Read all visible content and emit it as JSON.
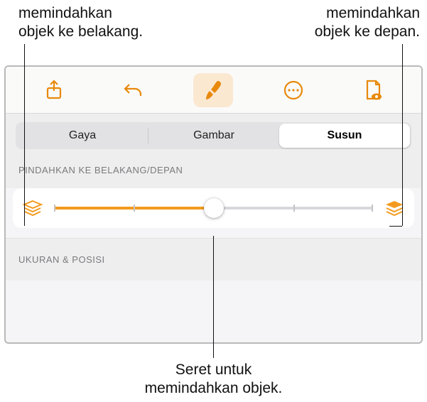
{
  "callouts": {
    "top_left": "memindahkan\nobjek ke belakang.",
    "top_right": "memindahkan\nobjek ke depan.",
    "bottom": "Seret untuk\nmemindahkan objek."
  },
  "toolbar": {
    "share": "share-icon",
    "undo": "undo-icon",
    "format": "format-brush-icon",
    "more": "more-icon",
    "document": "document-view-icon"
  },
  "tabs": {
    "style": "Gaya",
    "image": "Gambar",
    "arrange": "Susun",
    "selected_index": 2
  },
  "sections": {
    "backfront_title": "PINDAHKAN KE BELAKANG/DEPAN",
    "sizepos_title": "UKURAN & POSISI"
  },
  "slider": {
    "percent": 50,
    "ticks": [
      0,
      25,
      50,
      75,
      100
    ]
  },
  "colors": {
    "accent": "#f39a1e",
    "toolbar_icon": "#e8890b"
  }
}
